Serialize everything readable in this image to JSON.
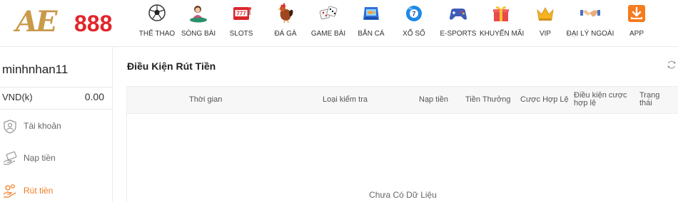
{
  "brand": {
    "logo_mark": "AE",
    "logo_number": "888"
  },
  "nav": [
    {
      "label": "THỂ THAO",
      "icon": "soccer-ball-icon"
    },
    {
      "label": "SÒNG BÀI",
      "icon": "casino-dealer-icon"
    },
    {
      "label": "SLOTS",
      "icon": "slot-machine-icon"
    },
    {
      "label": "ĐÁ GÀ",
      "icon": "rooster-icon"
    },
    {
      "label": "GAME BÀI",
      "icon": "dice-icon"
    },
    {
      "label": "BẮN CÁ",
      "icon": "fish-arcade-icon"
    },
    {
      "label": "XỔ SỐ",
      "icon": "lottery-ball-icon"
    },
    {
      "label": "E-SPORTS",
      "icon": "gamepad-icon"
    },
    {
      "label": "KHUYẾN MÃI",
      "icon": "gift-box-icon"
    },
    {
      "label": "VIP",
      "icon": "crown-icon"
    },
    {
      "label": "ĐẠI LÝ NGOÀI",
      "icon": "handshake-icon"
    },
    {
      "label": "APP",
      "icon": "download-icon"
    }
  ],
  "account": {
    "username": "minhnhan11",
    "currency_label": "VND(k)",
    "balance": "0.00"
  },
  "menu": [
    {
      "label": "Tài khoản",
      "icon": "user-shield-icon",
      "active": false
    },
    {
      "label": "Nạp tiền",
      "icon": "deposit-hand-icon",
      "active": false
    },
    {
      "label": "Rút tiền",
      "icon": "withdraw-hand-icon",
      "active": true
    }
  ],
  "page": {
    "title": "Điều Kiện Rút Tiền",
    "refresh_icon": "refresh-icon",
    "columns": [
      "Thời gian",
      "Loại kiểm tra",
      "Nạp tiền",
      "Tiền Thưởng",
      "Cược Hợp Lệ",
      "Điều kiện cược\nhợp lệ",
      "Trạng\nthái"
    ],
    "empty_text": "Chưa Có Dữ Liệu"
  },
  "colors": {
    "accent": "#f07a22",
    "brand_red": "#e2242a",
    "brand_gold": "#c99a4a"
  }
}
